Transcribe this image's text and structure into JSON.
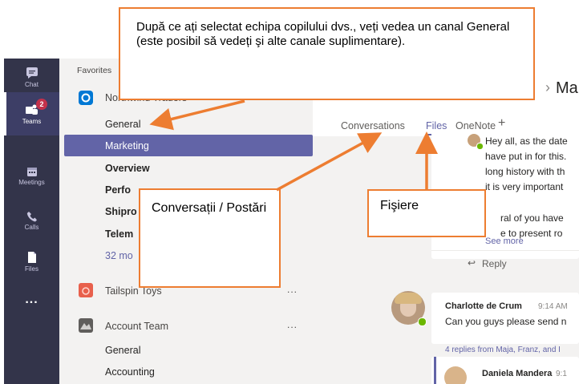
{
  "rail": {
    "items": [
      {
        "label": "Chat",
        "icon": "chat-icon"
      },
      {
        "label": "Teams",
        "icon": "teams-icon",
        "badge": "2",
        "active": true
      },
      {
        "label": "Meetings",
        "icon": "meetings-icon"
      },
      {
        "label": "Calls",
        "icon": "calls-icon"
      },
      {
        "label": "Files",
        "icon": "files-icon"
      },
      {
        "label": "...",
        "icon": "more-icon"
      }
    ]
  },
  "sidebar": {
    "favorites_label": "Favorites",
    "team1": {
      "name": "Northwind Traders",
      "more": "...",
      "channels": [
        "General",
        "Marketing",
        "Overview",
        "Perfo",
        "Shipro",
        "Telem"
      ],
      "more_channels": "32 mo"
    },
    "team2": {
      "name": "Tailspin Toys",
      "more": "..."
    },
    "team3": {
      "name": "Account Team",
      "more": "...",
      "channels": [
        "General",
        "Accounting"
      ]
    }
  },
  "content": {
    "header_title": "Mar",
    "tabs": [
      "Conversations",
      "Files",
      "OneNote"
    ],
    "add_tab": "+",
    "post1": {
      "lines": [
        "Hey all, as the date",
        "have put in for this.",
        "long history with th",
        "it is very important",
        "ral of you have",
        "e to present ro"
      ],
      "see_more": "See more",
      "reply": "Reply"
    },
    "post2": {
      "author": "Charlotte de Crum",
      "time": "9:14 AM",
      "text": "Can you guys please send n",
      "replies": "4 replies from Maja, Franz, and I",
      "reply_author": "Daniela Mandera",
      "reply_time": "9:1"
    }
  },
  "callouts": {
    "top": "După ce ați selectat echipa copilului dvs., veți vedea un canal General (este posibil să vedeți şi alte canale suplimentare).",
    "conversations": "Conversații / Postări",
    "files": "Fişiere"
  },
  "colors": {
    "rail": "#33344a",
    "accent": "#6264a7",
    "callout_border": "#ed7d31",
    "badge": "#c4314b"
  }
}
